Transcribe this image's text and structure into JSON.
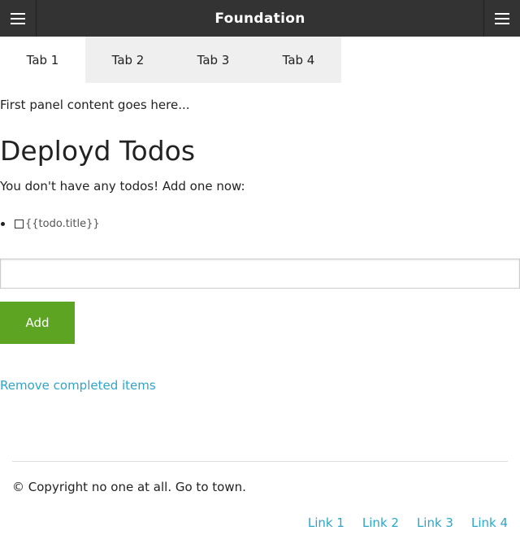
{
  "topbar": {
    "title": "Foundation",
    "left_menu_icon": "hamburger-icon",
    "right_menu_icon": "hamburger-icon"
  },
  "tabs": [
    {
      "label": "Tab 1",
      "active": true
    },
    {
      "label": "Tab 2",
      "active": false
    },
    {
      "label": "Tab 3",
      "active": false
    },
    {
      "label": "Tab 4",
      "active": false
    }
  ],
  "panel": {
    "content": "First panel content goes here..."
  },
  "todos": {
    "heading": "Deployd Todos",
    "empty_message": "You don't have any todos! Add one now:",
    "item_title": "{{todo.title}}",
    "input_value": "",
    "input_placeholder": "",
    "add_label": "Add",
    "remove_completed_label": "Remove completed items"
  },
  "footer": {
    "copyright": "© Copyright no one at all. Go to town.",
    "links": [
      "Link 1",
      "Link 2",
      "Link 3",
      "Link 4"
    ]
  },
  "colors": {
    "topbar_bg": "#333333",
    "tab_inactive_bg": "#efefef",
    "add_button_bg": "#5da423",
    "link": "#2ba6cb"
  }
}
